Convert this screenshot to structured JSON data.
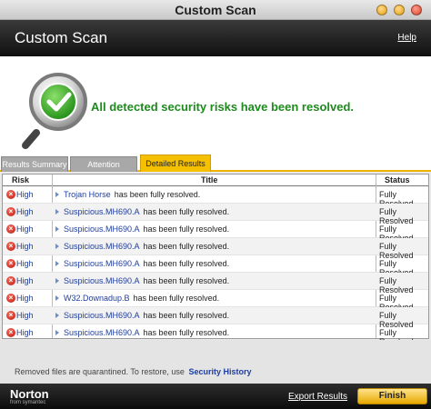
{
  "window": {
    "title": "Custom Scan"
  },
  "header": {
    "title": "Custom Scan",
    "help_label": "Help"
  },
  "hero": {
    "headline": "All detected security risks have been resolved."
  },
  "tabs": [
    {
      "label": "Results Summary",
      "active": false
    },
    {
      "label": "Attention Required",
      "active": false
    },
    {
      "label": "Detailed Results",
      "active": true
    }
  ],
  "table": {
    "columns": {
      "risk": "Risk",
      "title": "Title",
      "status": "Status"
    },
    "rows": [
      {
        "risk": "High",
        "threat": "Trojan Horse",
        "suffix": "has been fully resolved.",
        "status": "Fully Resolved"
      },
      {
        "risk": "High",
        "threat": "Suspicious.MH690.A",
        "suffix": "has been fully resolved.",
        "status": "Fully Resolved"
      },
      {
        "risk": "High",
        "threat": "Suspicious.MH690.A",
        "suffix": "has been fully resolved.",
        "status": "Fully Resolved"
      },
      {
        "risk": "High",
        "threat": "Suspicious.MH690.A",
        "suffix": "has been fully resolved.",
        "status": "Fully Resolved"
      },
      {
        "risk": "High",
        "threat": "Suspicious.MH690.A",
        "suffix": "has been fully resolved.",
        "status": "Fully Resolved"
      },
      {
        "risk": "High",
        "threat": "Suspicious.MH690.A",
        "suffix": "has been fully resolved.",
        "status": "Fully Resolved"
      },
      {
        "risk": "High",
        "threat": "W32.Downadup.B",
        "suffix": "has been fully resolved.",
        "status": "Fully Resolved"
      },
      {
        "risk": "High",
        "threat": "Suspicious.MH690.A",
        "suffix": "has been fully resolved.",
        "status": "Fully Resolved"
      },
      {
        "risk": "High",
        "threat": "Suspicious.MH690.A",
        "suffix": "has been fully resolved.",
        "status": "Fully Resolved"
      }
    ]
  },
  "footer": {
    "note": "Removed files are quarantined. To restore, use",
    "note_link": "Security History",
    "brand": "Norton",
    "brand_sub": "from symantec",
    "export_label": "Export Results",
    "finish_label": "Finish"
  },
  "icons": {
    "risk_icon": "error-x-icon",
    "success_icon": "magnifier-check-icon",
    "row_arrow": "triangle-right-icon"
  },
  "colors": {
    "headline_green": "#1e8a1e",
    "active_tab": "#f5c000",
    "link_blue": "#1f3e9e",
    "risk_red": "#b31a10"
  }
}
